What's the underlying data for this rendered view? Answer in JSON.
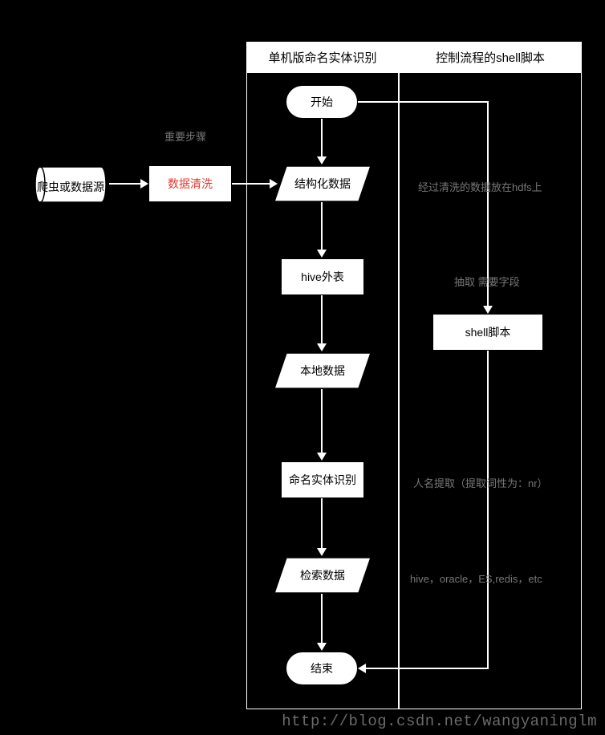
{
  "lanes": {
    "left": {
      "title": "单机版命名实体识别"
    },
    "right": {
      "title": "控制流程的shell脚本"
    }
  },
  "nodes": {
    "source": "爬虫或数据源",
    "clean": "数据清洗",
    "start": "开始",
    "structured": "结构化数据",
    "hive": "hive外表",
    "local": "本地数据",
    "ner": "命名实体识别",
    "search": "检索数据",
    "end": "结束",
    "shell": "shell脚本"
  },
  "annotations": {
    "important": "重要步骤",
    "hdfs": "经过清洗的数据放在hdfs上",
    "extract": "抽取 需要字段",
    "name": "人名提取（提取词性为：nr）",
    "sinks": "hive，oracle，ES,redis，etc"
  },
  "watermark": "http://blog.csdn.net/wangyaninglm"
}
